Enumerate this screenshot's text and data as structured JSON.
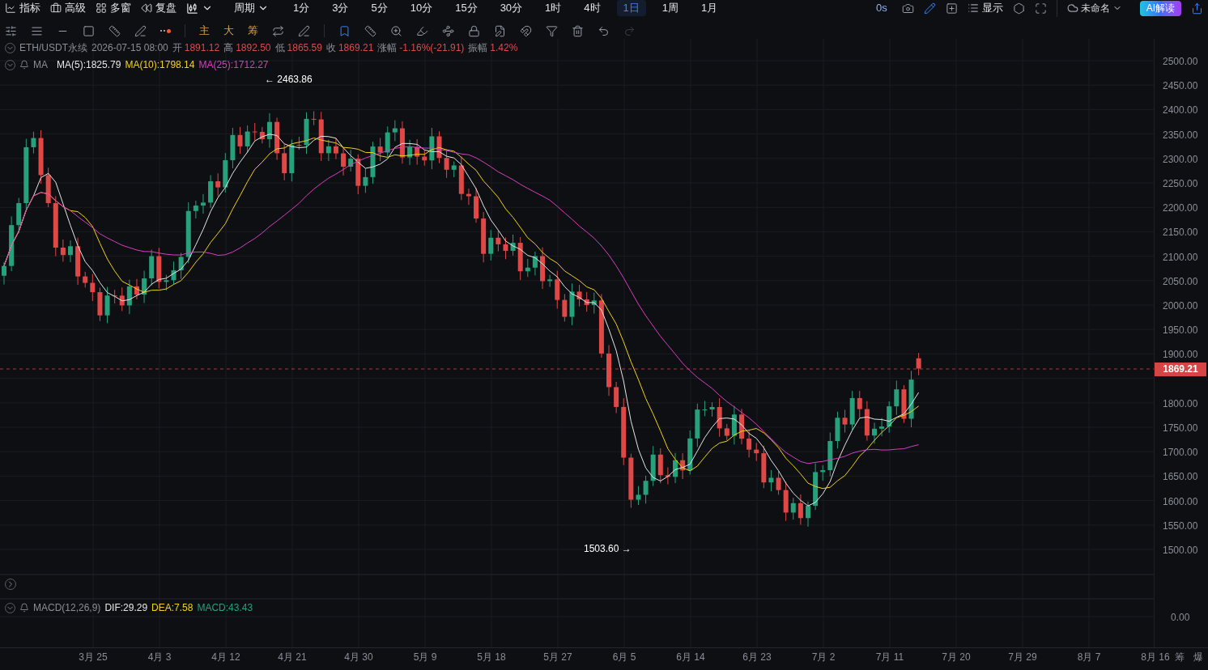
{
  "top_bar": {
    "menus": [
      {
        "label": "指标"
      },
      {
        "label": "高级"
      },
      {
        "label": "多窗"
      },
      {
        "label": "复盘"
      }
    ],
    "period_menu": "周期",
    "periods": [
      {
        "label": "1分",
        "selected": false
      },
      {
        "label": "3分",
        "selected": false
      },
      {
        "label": "5分",
        "selected": false
      },
      {
        "label": "10分",
        "selected": false
      },
      {
        "label": "15分",
        "selected": false
      },
      {
        "label": "30分",
        "selected": false
      },
      {
        "label": "1时",
        "selected": false
      },
      {
        "label": "4时",
        "selected": false
      },
      {
        "label": "1日",
        "selected": true
      },
      {
        "label": "1周",
        "selected": false
      },
      {
        "label": "1月",
        "selected": false
      }
    ],
    "countdown": "0s",
    "display_menu": "显示",
    "layout_name": "未命名",
    "ai_button": "AI解读"
  },
  "drawing_toolbar": {
    "indicator_toggles": [
      {
        "label": "主"
      },
      {
        "label": "大"
      },
      {
        "label": "筹"
      }
    ]
  },
  "legend": {
    "symbol": "ETH/USDT永续",
    "datetime": "2026-07-15 08:00",
    "fields": [
      {
        "label": "开",
        "value": "1891.12"
      },
      {
        "label": "高",
        "value": "1892.50"
      },
      {
        "label": "低",
        "value": "1865.59"
      },
      {
        "label": "收",
        "value": "1869.21"
      },
      {
        "label": "涨幅",
        "value": "-1.16%(-21.91)"
      },
      {
        "label": "振幅",
        "value": "1.42%"
      }
    ]
  },
  "ma_legend": {
    "label": "MA",
    "items": [
      {
        "text": "MA(5):1825.79",
        "color": "#e6e6e6"
      },
      {
        "text": "MA(10):1798.14",
        "color": "#f0d21c"
      },
      {
        "text": "MA(25):1712.27",
        "color": "#d63fc0"
      }
    ]
  },
  "annotations": {
    "high": "← 2463.86",
    "low": "1503.60 →"
  },
  "price_axis": [
    "2500.00",
    "2450.00",
    "2400.00",
    "2350.00",
    "2300.00",
    "2250.00",
    "2200.00",
    "2150.00",
    "2100.00",
    "2050.00",
    "2000.00",
    "1950.00",
    "1900.00",
    "1800.00",
    "1750.00",
    "1700.00",
    "1650.00",
    "1600.00",
    "1550.00",
    "1500.00"
  ],
  "last_price": "1869.21",
  "macd_legend": {
    "label": "MACD(12,26,9)",
    "items": [
      {
        "text": "DIF:29.29",
        "color": "#e6e6e6"
      },
      {
        "text": "DEA:7.58",
        "color": "#f0d21c"
      },
      {
        "text": "MACD:43.43",
        "color": "#26a17b"
      }
    ]
  },
  "macd_axis": "0.00",
  "time_axis": [
    "3月 25",
    "4月 3",
    "4月 12",
    "4月 21",
    "4月 30",
    "5月 9",
    "5月 18",
    "5月 27",
    "6月 5",
    "6月 14",
    "6月 23",
    "7月 2",
    "7月 11",
    "7月 20",
    "7月 29",
    "8月 7",
    "8月 16"
  ],
  "bottom_toggles": [
    {
      "label": "筹"
    },
    {
      "label": "爆"
    }
  ]
}
